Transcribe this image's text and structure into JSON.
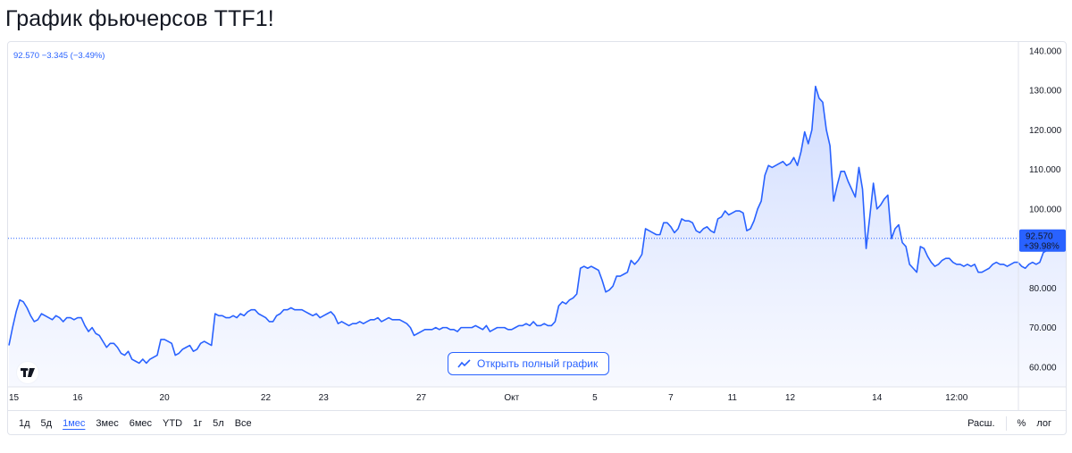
{
  "page": {
    "title": "График фьючерсов TTF1!"
  },
  "legend": {
    "text": "92.570 −3.345 (−3.49%)"
  },
  "open_chart_button": {
    "label": "Открыть полный график",
    "icon": "chart-line-icon"
  },
  "last_price": {
    "value": "92.570",
    "change": "+39.98%",
    "color": "#2962ff"
  },
  "periods": [
    {
      "label": "1д",
      "active": false
    },
    {
      "label": "5д",
      "active": false
    },
    {
      "label": "1мес",
      "active": true
    },
    {
      "label": "3мес",
      "active": false
    },
    {
      "label": "6мес",
      "active": false
    },
    {
      "label": "YTD",
      "active": false
    },
    {
      "label": "1г",
      "active": false
    },
    {
      "label": "5л",
      "active": false
    },
    {
      "label": "Все",
      "active": false
    }
  ],
  "tools": {
    "scale": "Расш.",
    "percent": "%",
    "log": "лог"
  },
  "colors": {
    "line": "#2962ff",
    "area_top": "#c9d7ff",
    "area_bottom": "#f2f5ff",
    "border": "#e0e3eb"
  },
  "chart_data": {
    "type": "area",
    "title": "",
    "xlabel": "",
    "ylabel": "",
    "ylim": [
      55,
      142
    ],
    "y_ticks": [
      "140.000",
      "130.000",
      "120.000",
      "110.000",
      "100.000",
      "90.000",
      "80.000",
      "70.000",
      "60.000"
    ],
    "y_tick_values": [
      140,
      130,
      120,
      110,
      100,
      90,
      80,
      70,
      60
    ],
    "x_ticks": [
      {
        "label": "15",
        "idx": 0
      },
      {
        "label": "16",
        "idx": 19
      },
      {
        "label": "20",
        "idx": 43
      },
      {
        "label": "22",
        "idx": 71
      },
      {
        "label": "23",
        "idx": 87
      },
      {
        "label": "27",
        "idx": 114
      },
      {
        "label": "Окт",
        "idx": 139
      },
      {
        "label": "5",
        "idx": 162
      },
      {
        "label": "7",
        "idx": 183
      },
      {
        "label": "11",
        "idx": 200
      },
      {
        "label": "12",
        "idx": 216
      },
      {
        "label": "14",
        "idx": 240
      },
      {
        "label": "12:00",
        "idx": 262
      }
    ],
    "x_count": 266,
    "last_value": 92.57,
    "series": [
      {
        "values": [
          65.5,
          70,
          74,
          77,
          76.5,
          75,
          73,
          71.5,
          72,
          73.5,
          73,
          72.5,
          72,
          73,
          72.5,
          71.5,
          72.5,
          72.5,
          72,
          72.5,
          72.5,
          70.5,
          69,
          70,
          68.5,
          68,
          66.5,
          65,
          66,
          66,
          65,
          63.5,
          63,
          64,
          62,
          61.5,
          61,
          62,
          61,
          62,
          62.5,
          63,
          67,
          67,
          66.5,
          66,
          63,
          63.5,
          64.5,
          65,
          65.5,
          64,
          64.5,
          66,
          66.5,
          66,
          65.5,
          73.5,
          73,
          73,
          72.5,
          72.5,
          73,
          72.5,
          73.5,
          73,
          74,
          74.5,
          74.5,
          73.5,
          73,
          72.5,
          71.5,
          71.5,
          73,
          73.5,
          74.5,
          74.5,
          75,
          74.5,
          74.5,
          74.5,
          74,
          73.5,
          73,
          73.5,
          72.5,
          73,
          73.5,
          74,
          73,
          71,
          71.5,
          71,
          70.5,
          71,
          71,
          71.5,
          71,
          71.5,
          72,
          72,
          72.5,
          71.5,
          72,
          72.5,
          72,
          72,
          72,
          71.5,
          71,
          70,
          68,
          68.5,
          69,
          69.5,
          69.5,
          69.5,
          70,
          69.5,
          70,
          70,
          69.5,
          69.5,
          69,
          70,
          70,
          70,
          70,
          70.5,
          70,
          69.5,
          70.5,
          69,
          69.5,
          70,
          70,
          70,
          69.5,
          69.5,
          70,
          70.5,
          70.5,
          71,
          70.5,
          71.5,
          70.5,
          70.5,
          71,
          70.5,
          70.5,
          71.5,
          75.5,
          76.5,
          76,
          77,
          77.5,
          78.5,
          85,
          85.5,
          85,
          85.5,
          85,
          84.5,
          82,
          79,
          79.5,
          80.5,
          83,
          83,
          83.5,
          84,
          87,
          86,
          87,
          88.5,
          95,
          94.5,
          94,
          93.5,
          93.5,
          96.5,
          96.5,
          95.5,
          94,
          95,
          97.5,
          97,
          97,
          96.5,
          94.5,
          94,
          95,
          95.5,
          94.5,
          94,
          97.5,
          98,
          99.5,
          98.5,
          99,
          99.5,
          99.5,
          99,
          94.5,
          95,
          97,
          100,
          102,
          108.5,
          111,
          110.5,
          111,
          111.5,
          112,
          111,
          111.5,
          113,
          111,
          114.5,
          119.5,
          116.5,
          120,
          131,
          128,
          127,
          120,
          116,
          102,
          106,
          109.5,
          109.5,
          107,
          105,
          103,
          110.5,
          105,
          90,
          98,
          106.5,
          100,
          101,
          102.5,
          103.5,
          92.5,
          95,
          96,
          91.5,
          90.5,
          86,
          85,
          84,
          90.5,
          90,
          88,
          86.5,
          85.5,
          86,
          87,
          87.5,
          87.5,
          86.5,
          86,
          86,
          85.5,
          86,
          85.5,
          86,
          84,
          84,
          84.5,
          85,
          86,
          86.5,
          86,
          86,
          85.5,
          86,
          86.5,
          86.5,
          85.5,
          85,
          86,
          86.5,
          86,
          86.5,
          89,
          89.5,
          90,
          89.5,
          90,
          90.5,
          90,
          90,
          91,
          91.5,
          93,
          97,
          96.5,
          97,
          98,
          97,
          96.5,
          99,
          98.5,
          100,
          101,
          102,
          101,
          104,
          105,
          101.5,
          98.5,
          96,
          96.5,
          97,
          96,
          96,
          95.5,
          96,
          96.5,
          96.5,
          96,
          97,
          97.5,
          97,
          96.5,
          95.5,
          94,
          92.57
        ]
      }
    ],
    "legend": "none",
    "grid": false
  }
}
